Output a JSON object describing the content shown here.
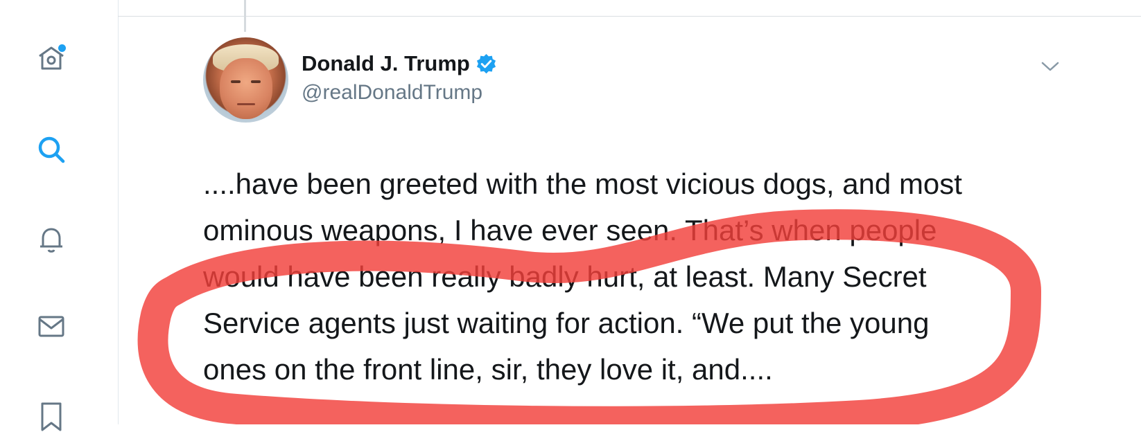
{
  "nav": {
    "items": [
      {
        "name": "home-icon",
        "active": false,
        "badge": true
      },
      {
        "name": "search-icon",
        "active": true,
        "badge": false
      },
      {
        "name": "notifications-icon",
        "active": false,
        "badge": false
      },
      {
        "name": "messages-icon",
        "active": false,
        "badge": false
      },
      {
        "name": "bookmark-icon",
        "active": false,
        "badge": false
      }
    ],
    "accent_color": "#1da1f2",
    "icon_color": "#657786"
  },
  "tweet": {
    "author_name": "Donald J. Trump",
    "handle": "@realDonaldTrump",
    "verified": true,
    "text_lines": [
      "....have been greeted with the most vicious dogs, and most",
      "ominous weapons, I have ever seen. That’s when people",
      "would have been really badly hurt, at least. Many Secret",
      "Service agents just waiting for action. “We put the young",
      "ones on the front line, sir, they love it, and...."
    ]
  },
  "annotation": {
    "type": "hand-drawn-ellipse",
    "color": "#f2403b"
  }
}
